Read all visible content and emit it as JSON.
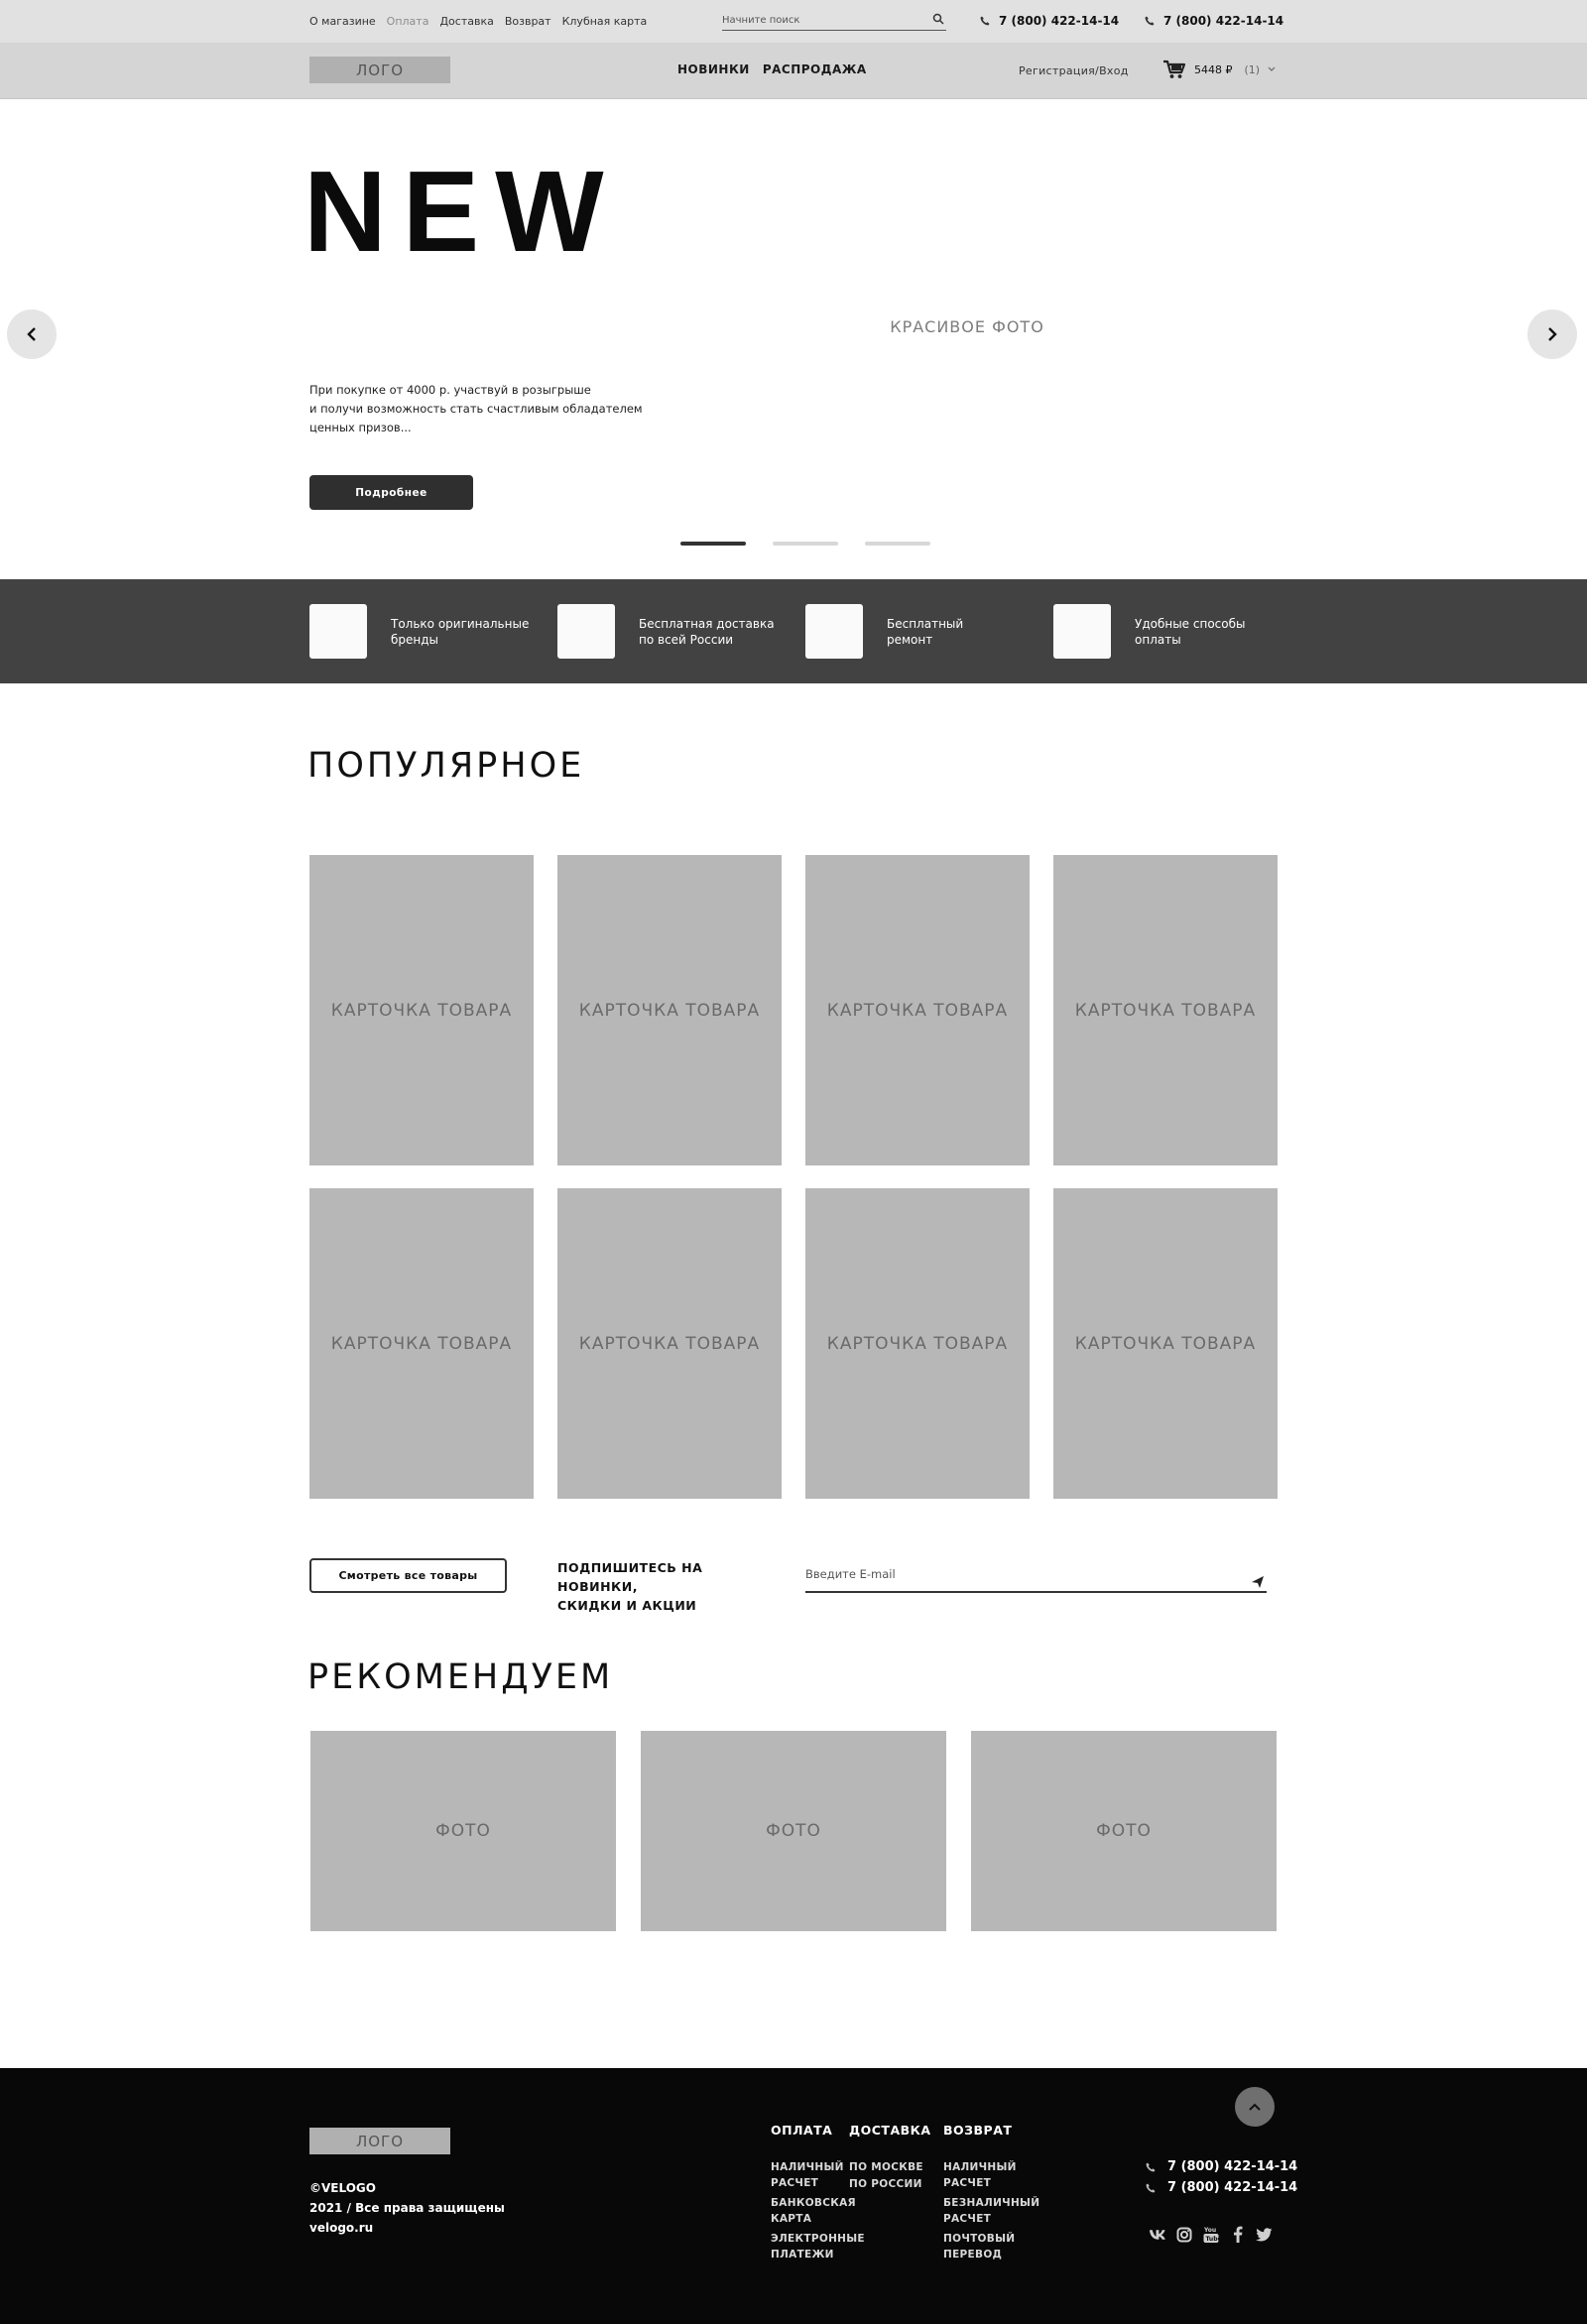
{
  "topbar": {
    "links": [
      {
        "label": "О магазине",
        "active": false
      },
      {
        "label": "Оплата",
        "active": true
      },
      {
        "label": "Доставка",
        "active": false
      },
      {
        "label": "Возврат",
        "active": false
      },
      {
        "label": "Клубная карта",
        "active": false
      }
    ],
    "search_placeholder": "Начните поиск",
    "phone1": "7 (800) 422-14-14",
    "phone2": "7 (800) 422-14-14"
  },
  "header": {
    "logo": "ЛОГО",
    "nav": [
      "НОВИНКИ",
      "РАСПРОДАЖА"
    ],
    "auth": "Регистрация/Вход",
    "cart_total": "5448 ₽",
    "cart_count": "(1)"
  },
  "hero": {
    "title": "NEW",
    "photo_label": "КРАСИВОЕ ФОТО",
    "text_line1": "При покупке от 4000 р. участвуй в розыгрыше",
    "text_line2": "и получи возможность стать счастливым обладателем",
    "text_line3": "ценных призов...",
    "button": "Подробнее",
    "slides_total": 3,
    "slide_active": 1
  },
  "features": [
    {
      "line1": "Только оригинальные",
      "line2": "бренды"
    },
    {
      "line1": "Бесплатная доставка",
      "line2": "по всей России"
    },
    {
      "line1": "Бесплатный",
      "line2": "ремонт"
    },
    {
      "line1": "Удобные способы",
      "line2": "оплаты"
    }
  ],
  "popular": {
    "title": "ПОПУЛЯРНОЕ",
    "cards": [
      "КАРТОЧКА ТОВАРА",
      "КАРТОЧКА ТОВАРА",
      "КАРТОЧКА ТОВАРА",
      "КАРТОЧКА ТОВАРА",
      "КАРТОЧКА ТОВАРА",
      "КАРТОЧКА ТОВАРА",
      "КАРТОЧКА ТОВАРА",
      "КАРТОЧКА ТОВАРА"
    ],
    "view_all": "Смотреть все товары",
    "subscribe_line1": "ПОДПИШИТЕСЬ НА НОВИНКИ,",
    "subscribe_line2": "СКИДКИ И АКЦИИ",
    "email_placeholder": "Введите E-mail"
  },
  "recommend": {
    "title": "РЕКОМЕНДУЕМ",
    "photos": [
      "ФОТО",
      "ФОТО",
      "ФОТО"
    ]
  },
  "footer": {
    "logo": "ЛОГО",
    "copyright": "©VELOGO",
    "rights": "2021 / Все права защищены",
    "site": "velogo.ru",
    "columns": [
      {
        "head": "ОПЛАТА",
        "links": [
          [
            "НАЛИЧНЫЙ",
            "РАСЧЕТ"
          ],
          [
            "БАНКОВСКАЯ",
            "КАРТА"
          ],
          [
            "ЭЛЕКТРОННЫЕ",
            "ПЛАТЕЖИ"
          ]
        ]
      },
      {
        "head": "ДОСТАВКА",
        "links": [
          [
            "ПО МОСКВЕ"
          ],
          [
            "ПО РОССИИ"
          ]
        ]
      },
      {
        "head": "ВОЗВРАТ",
        "links": [
          [
            "НАЛИЧНЫЙ",
            "РАСЧЕТ"
          ],
          [
            "БЕЗНАЛИЧНЫЙ",
            "РАСЧЕТ"
          ],
          [
            "ПОЧТОВЫЙ",
            "ПЕРЕВОД"
          ]
        ]
      }
    ],
    "phone1": "7 (800) 422-14-14",
    "phone2": "7 (800) 422-14-14",
    "social": [
      "vk-icon",
      "instagram-icon",
      "youtube-icon",
      "facebook-icon",
      "twitter-icon"
    ]
  },
  "colors": {
    "topbar": "#e2e1e2",
    "header": "#d6d5d6",
    "features_band": "#424242",
    "placeholder": "#b7b7b7",
    "footer": "#080808"
  }
}
